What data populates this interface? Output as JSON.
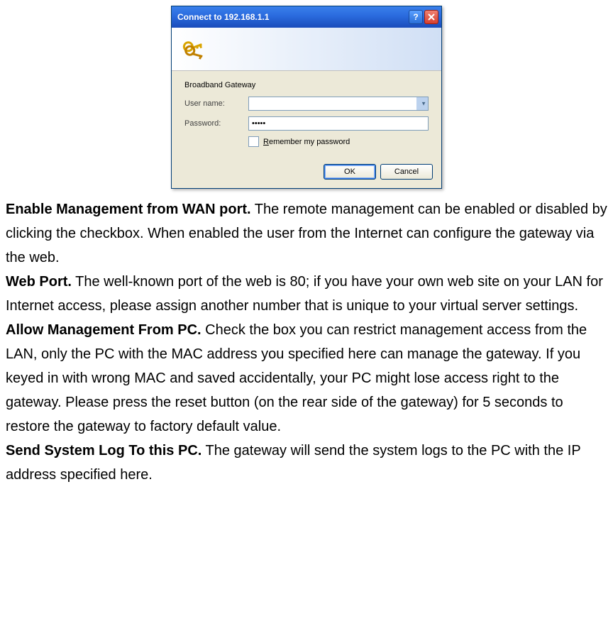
{
  "dialog": {
    "title": "Connect to 192.168.1.1",
    "realm": "Broadband Gateway",
    "labels": {
      "username": "User name:",
      "password": "Password:"
    },
    "username_value": "",
    "password_value": "•••••",
    "remember_prefix": "R",
    "remember_label": "emember my password",
    "buttons": {
      "ok": "OK",
      "cancel": "Cancel"
    }
  },
  "doc": {
    "p1": {
      "strong": "Enable Management from WAN port.",
      "text": " The remote management can be enabled or disabled by clicking the checkbox. When enabled the user from the Internet can configure the gateway via the web."
    },
    "p2": {
      "strong": "Web Port.",
      "text": " The well-known port of the web is 80; if you have your own web site on your LAN for Internet access, please assign another number that is unique to your virtual server settings."
    },
    "p3": {
      "strong": "Allow Management From PC.",
      "text": " Check the box you can restrict management access from the LAN, only the PC with the MAC address you specified here can manage the gateway. If you keyed in with wrong MAC and saved accidentally, your PC might lose access right to the gateway. Please press the reset button (on the rear side of the gateway) for 5 seconds to restore the gateway to factory default value."
    },
    "p4": {
      "strong": "Send System Log To this PC.",
      "text": " The gateway will send the system logs to the PC with the IP address specified here."
    }
  }
}
